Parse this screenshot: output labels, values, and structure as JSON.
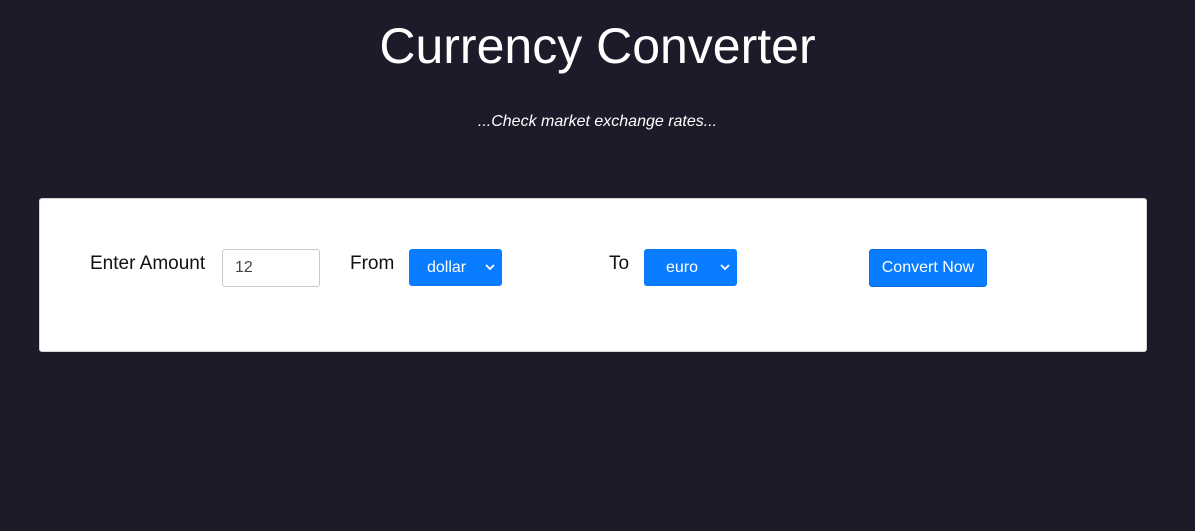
{
  "header": {
    "title": "Currency Converter",
    "subtitle": "...Check market exchange rates..."
  },
  "form": {
    "amount_label": "Enter Amount",
    "amount_value": "12",
    "from_label": "From",
    "from_selected": "dollar",
    "to_label": "To",
    "to_selected": "euro",
    "convert_label": "Convert Now"
  },
  "icons": {
    "dropdown": "chevron-down-icon"
  },
  "colors": {
    "background": "#1c1b2a",
    "accent": "#0a7cff",
    "card": "#ffffff"
  }
}
